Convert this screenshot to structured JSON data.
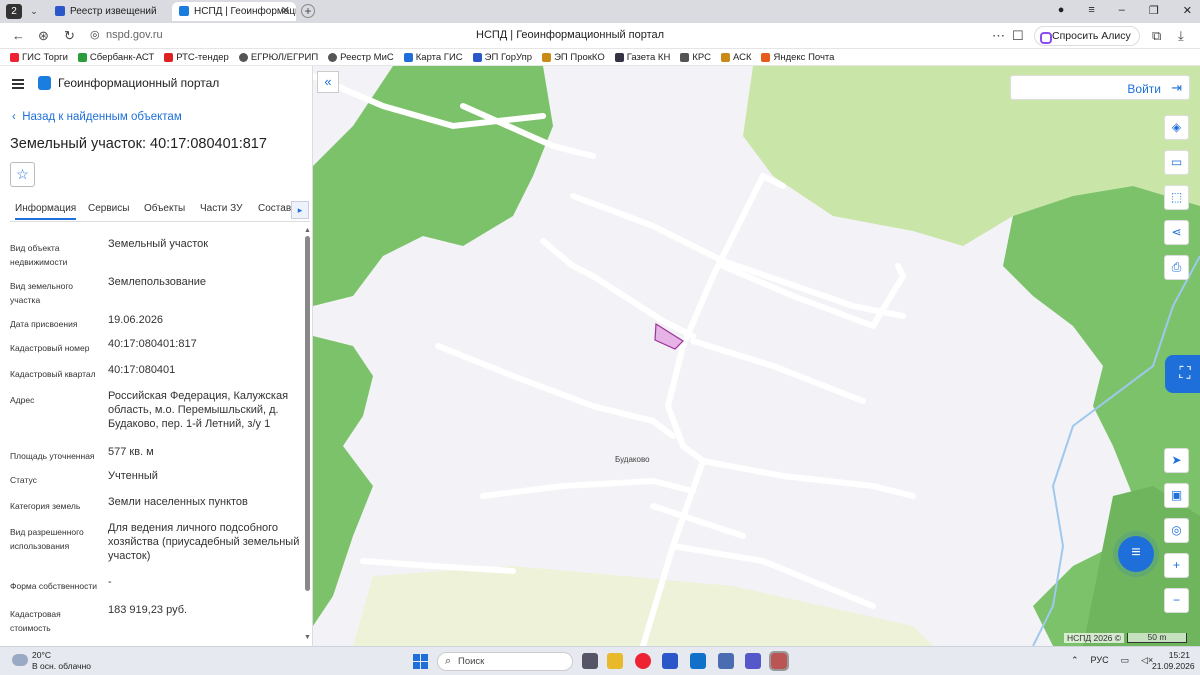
{
  "browser": {
    "tab_count": "2",
    "tabs": [
      {
        "title": "Реестр извещений"
      },
      {
        "title": "НСПД | Геоинформаци"
      }
    ],
    "url": "nspd.gov.ru",
    "page_title": "НСПД | Геоинформационный портал",
    "alice_button": "Спросить Алису AI",
    "bookmarks": [
      "ГИС Торги",
      "Сбербанк-АСТ",
      "РТС-тендер",
      "ЕГРЮЛ/ЕГРИП",
      "Реестр МиС",
      "Карта ГИС",
      "ЭП ГорУпр",
      "ЭП ПрокКО",
      "Газета КН",
      "КРС",
      "АСК",
      "Яндекс Почта"
    ]
  },
  "sidebar": {
    "portal_title": "Геоинформационный портал",
    "back_link": "Назад к найденным объектам",
    "parcel_title": "Земельный участок: 40:17:080401:817",
    "tabs": [
      "Информация",
      "Сервисы",
      "Объекты",
      "Части ЗУ",
      "Состав"
    ],
    "properties": [
      {
        "key": "Вид объекта недвижимости",
        "value": "Земельный участок"
      },
      {
        "key": "Вид земельного участка",
        "value": "Землепользование"
      },
      {
        "key": "Дата присвоения",
        "value": "19.06.2026"
      },
      {
        "key": "Кадастровый номер",
        "value": "40:17:080401:817"
      },
      {
        "key": "Кадастровый квартал",
        "value": "40:17:080401"
      },
      {
        "key": "Адрес",
        "value": "Российская Федерация, Калужская область, м.о. Перемышльский, д. Будаково, пер. 1-й Летний, з/у 1"
      },
      {
        "key": "Площадь уточненная",
        "value": "577 кв. м"
      },
      {
        "key": "Статус",
        "value": "Учтенный"
      },
      {
        "key": "Категория земель",
        "value": "Земли населенных пунктов"
      },
      {
        "key": "Вид разрешенного использования",
        "value": "Для ведения личного подсобного хозяйства (приусадебный земельный участок)"
      },
      {
        "key": "Форма собственности",
        "value": "-"
      },
      {
        "key": "Кадастровая стоимость",
        "value": "183 919,23 руб."
      }
    ]
  },
  "map": {
    "login_label": "Войти",
    "village_label": "Будаково",
    "attribution": "НСПД 2026 ©",
    "scale_label": "50 m"
  },
  "taskbar": {
    "temperature": "20°C",
    "weather": "В осн. облачно",
    "search_placeholder": "Поиск",
    "lang": "РУС",
    "time": "15:21",
    "date": "21.09.2026"
  },
  "colors": {
    "accent": "#1e6fd9",
    "forest": "#7cc26a",
    "meadow": "#c9e6a8",
    "parcel_fill": "#e6b3e6",
    "parcel_stroke": "#a0309a"
  }
}
